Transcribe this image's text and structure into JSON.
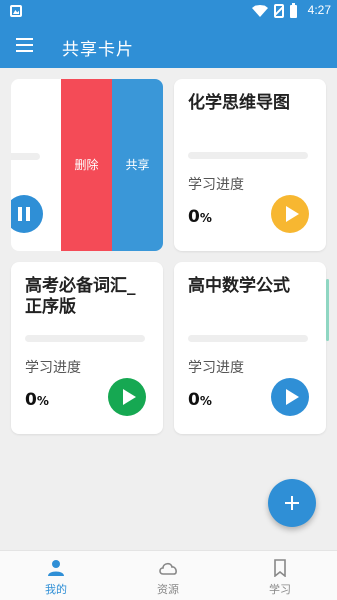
{
  "status_bar": {
    "time": "4:27"
  },
  "app_bar": {
    "title": "共享卡片"
  },
  "swipe_actions": {
    "delete_label": "删除",
    "share_label": "共享"
  },
  "cards": [
    {
      "title": "化学思维导图",
      "progress_label": "学习进度",
      "progress_value": "0",
      "progress_unit": "%",
      "progress": 0,
      "button_color": "#f7b731"
    },
    {
      "title": "高考必备词汇_正序版",
      "progress_label": "学习进度",
      "progress_value": "0",
      "progress_unit": "%",
      "progress": 0,
      "button_color": "#16a852"
    },
    {
      "title": "高中数学公式",
      "progress_label": "学习进度",
      "progress_value": "0",
      "progress_unit": "%",
      "progress": 0,
      "button_color": "#2f8fd6"
    }
  ],
  "bottom_nav": {
    "items": [
      {
        "label": "我的",
        "icon": "person-icon",
        "active": true
      },
      {
        "label": "资源",
        "icon": "cloud-icon",
        "active": false
      },
      {
        "label": "学习",
        "icon": "bookmark-icon",
        "active": false
      }
    ]
  },
  "colors": {
    "primary": "#2f8fd6",
    "delete": "#f44b57",
    "share": "#3a97d8"
  }
}
